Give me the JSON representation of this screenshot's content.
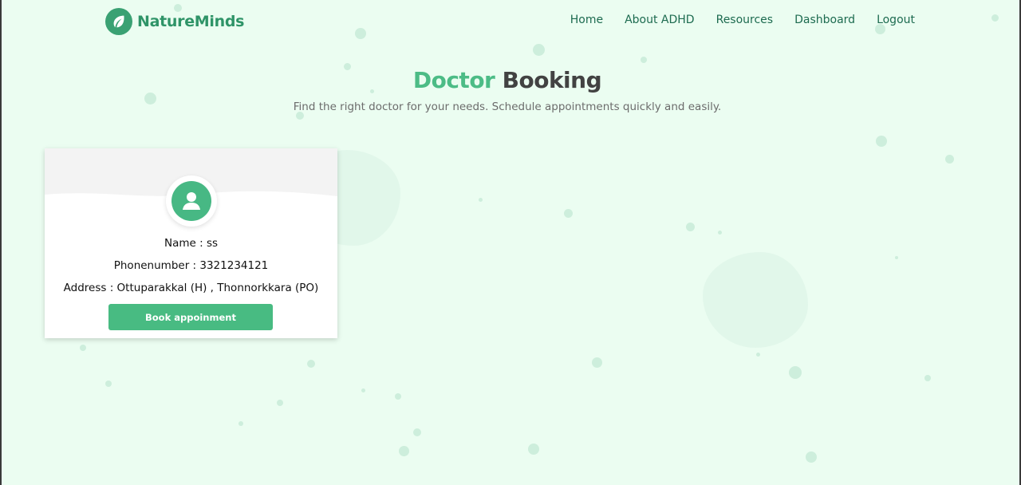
{
  "brand": {
    "name": "NatureMinds",
    "icon": "leaf-icon",
    "color": "#3aa173"
  },
  "nav": {
    "items": [
      {
        "label": "Home"
      },
      {
        "label": "About ADHD"
      },
      {
        "label": "Resources"
      },
      {
        "label": "Dashboard"
      },
      {
        "label": "Logout"
      }
    ]
  },
  "page": {
    "title_accent": "Doctor",
    "title_rest": "Booking",
    "subtitle": "Find the right doctor for your needs. Schedule appointments quickly and easily."
  },
  "doctors": [
    {
      "avatar_icon": "user-icon",
      "name_line": "Name : ss",
      "phone_line": "Phonenumber : 3321234121",
      "address_line": "Address : Ottuparakkal (H) , Thonnorkkara (PO)",
      "button_label": "Book appoinment"
    }
  ],
  "colors": {
    "background": "#ebfdf1",
    "accent": "#48bb82",
    "title_dark": "#424242",
    "nav_text": "#1d6b50"
  }
}
